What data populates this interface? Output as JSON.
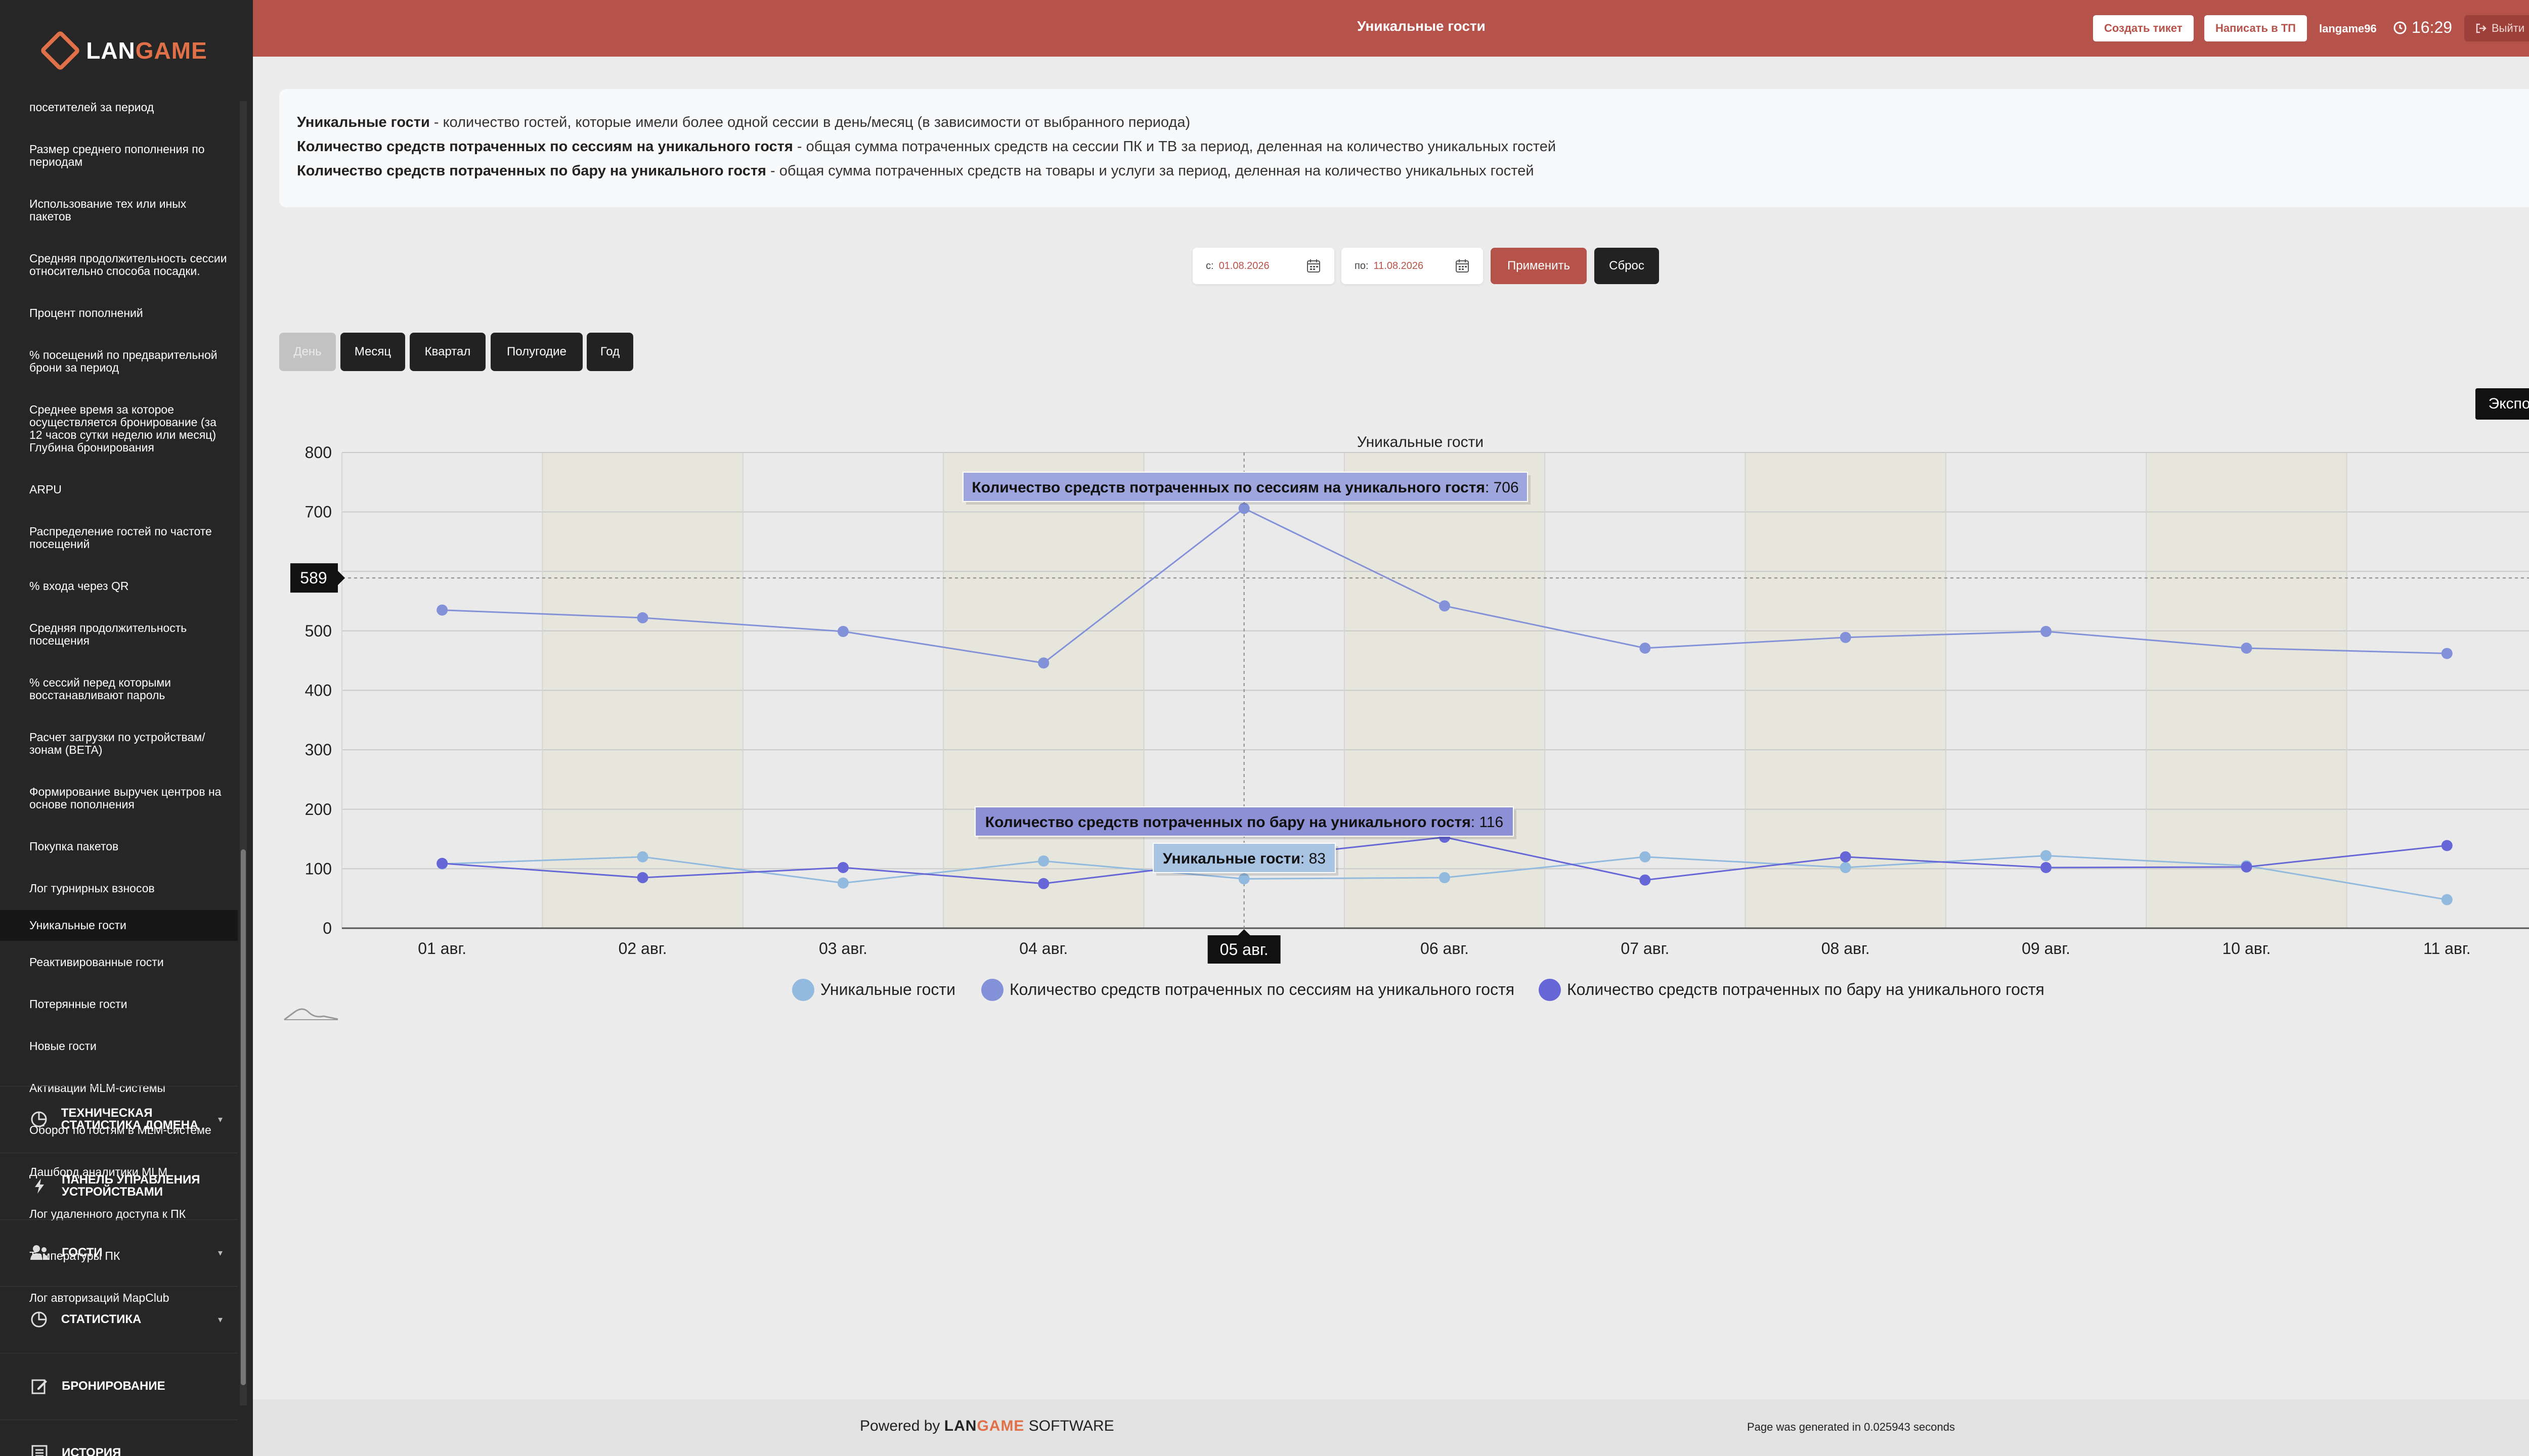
{
  "app": {
    "logo_prefix": "LAN",
    "logo_suffix": "GAME",
    "page_title": "Уникальные гости"
  },
  "topbar": {
    "create_ticket": "Создать тикет",
    "write_support": "Написать в ТП",
    "username": "langame96",
    "time": "16:29",
    "logout": "Выйти"
  },
  "sidebar": {
    "items": [
      "посетителей за период",
      "Размер среднего пополнения по периодам",
      "Использование тех или иных пакетов",
      "Средняя продолжительность сессии относительно способа посадки.",
      "Процент пополнений",
      "% посещений по предварительной брони за период",
      "Среднее время за которое осуществляется бронирование (за 12 часов сутки неделю или месяц) Глубина бронирования",
      "ARPU",
      "Распределение гостей по частоте посещений",
      "% входа через QR",
      "Средняя продолжительность посещения",
      "% сессий перед которыми восстанавливают пароль",
      "Расчет загрузки по устройствам/ зонам (BETA)",
      "Формирование выручек центров на основе пополнения",
      "Покупка пакетов",
      "Лог турнирных взносов",
      "Уникальные гости",
      "Реактивированные гости",
      "Потерянные гости",
      "Новые гости",
      "Активации MLM-системы",
      "Оборот по гостям в MLM-системе",
      "Дашборд аналитики MLM",
      "Лог удаленного доступа к ПК",
      "Температуры ПК",
      "Лог авторизаций MapClub"
    ],
    "active_index": 16,
    "groups": [
      {
        "label": "Техническая статистика домена",
        "icon": "chart-pie-icon",
        "caret": true
      },
      {
        "label": "Панель управления устройствами",
        "icon": "lightning-icon",
        "caret": false
      },
      {
        "label": "Гости",
        "icon": "users-icon",
        "caret": true
      },
      {
        "label": "Статистика",
        "icon": "chart-pie-icon",
        "caret": true
      },
      {
        "label": "Бронирование",
        "icon": "edit-icon",
        "caret": false
      },
      {
        "label": "История",
        "icon": "list-icon",
        "caret": false
      }
    ]
  },
  "info": {
    "line1_term": "Уникальные гости",
    "line1_desc": " - количество гостей, которые имели более одной сессии в день/месяц (в зависимости от выбранного периода)",
    "line2_term": "Количество средств потраченных по сессиям на уникального гостя",
    "line2_desc": " - общая сумма потраченных средств на сессии ПК и ТВ за период, деленная на количество уникальных гостей",
    "line3_term": "Количество средств потраченных по бару на уникального гостя",
    "line3_desc": " - общая сумма потраченных средств на товары и услуги за период, деленная на количество уникальных гостей"
  },
  "filters": {
    "from_label": "с:",
    "from_value": "01.08.2026",
    "to_label": "по:",
    "to_value": "11.08.2026",
    "apply": "Применить",
    "reset": "Сброс",
    "periods": [
      "День",
      "Месяц",
      "Квартал",
      "Полугодие",
      "Год"
    ],
    "active_period": "День",
    "export": "Экспорт"
  },
  "colors": {
    "accent": "#b5534b",
    "series1": "#92b9de",
    "series2": "#8391d8",
    "series3": "#6666d6",
    "band": "#e6e6dc"
  },
  "chart_data": {
    "type": "line",
    "title": "Уникальные гости",
    "categories": [
      "01 авг.",
      "02 авг.",
      "03 авг.",
      "04 авг.",
      "05 авг.",
      "06 авг.",
      "07 авг.",
      "08 авг.",
      "09 авг.",
      "10 авг.",
      "11 авг."
    ],
    "ylim": [
      0,
      800
    ],
    "yticks": [
      0,
      100,
      200,
      300,
      400,
      500,
      600,
      700,
      800
    ],
    "ytick_labels": [
      "0",
      "100",
      "200",
      "300",
      "400",
      "500",
      "",
      "700",
      "800"
    ],
    "grid": true,
    "legend_position": "bottom",
    "series": [
      {
        "name": "Уникальные гости",
        "values": [
          108,
          120,
          76,
          113,
          83,
          85,
          120,
          102,
          122,
          105,
          48
        ]
      },
      {
        "name": "Количество средств потраченных по сессиям на уникального гостя",
        "values": [
          535,
          522,
          499,
          446,
          706,
          542,
          471,
          489,
          499,
          471,
          462
        ]
      },
      {
        "name": "Количество средств потраченных по бару на уникального гостя",
        "values": [
          109,
          85,
          102,
          75,
          116,
          153,
          81,
          120,
          102,
          103,
          139
        ]
      }
    ],
    "crosshair": {
      "category": "05 авг.",
      "y_value": "589"
    },
    "tooltips": [
      {
        "series": "Количество средств потраченных по сессиям на уникального гостя",
        "value": "706"
      },
      {
        "series": "Количество средств потраченных по бару на уникального гостя",
        "value": "116"
      },
      {
        "series": "Уникальные гости",
        "value": "83"
      }
    ]
  },
  "footer": {
    "powered_by": "Powered by",
    "software": "SOFTWARE",
    "generated": "Page was generated in 0.025943 seconds"
  }
}
